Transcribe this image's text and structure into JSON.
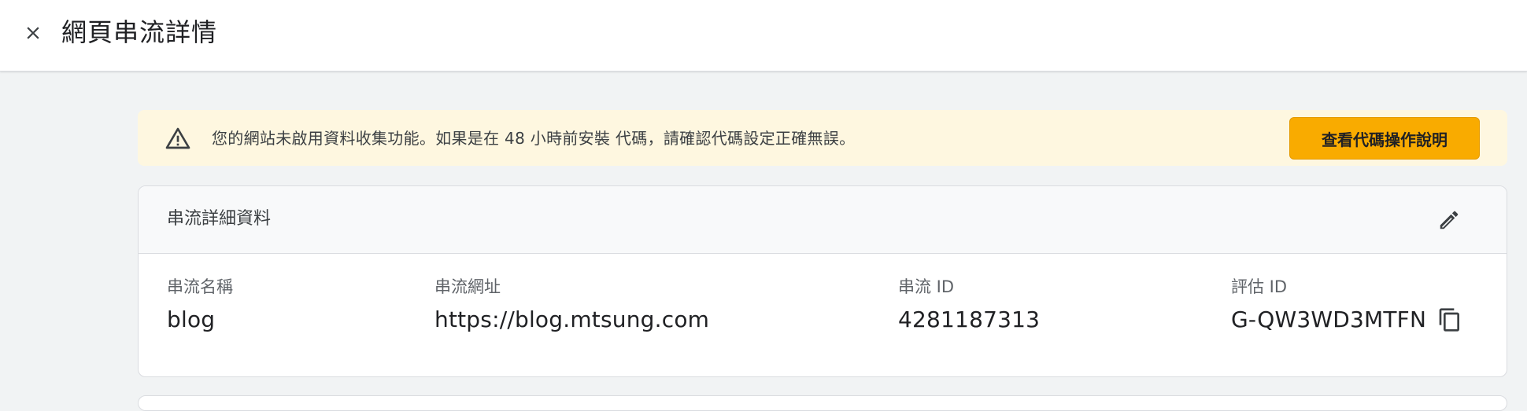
{
  "header": {
    "close_icon": "close-icon",
    "title": "網頁串流詳情"
  },
  "banner": {
    "icon": "warning-icon",
    "message": "您的網站未啟用資料收集功能。如果是在 48 小時前安裝 代碼，請確認代碼設定正確無誤。",
    "button_label": "查看代碼操作說明",
    "background_color": "#fef7e0",
    "button_color": "#f9ab00"
  },
  "stream_details": {
    "title": "串流詳細資料",
    "edit_icon": "edit-pencil-icon",
    "fields": [
      {
        "label": "串流名稱",
        "value": "blog"
      },
      {
        "label": "串流網址",
        "value": "https://blog.mtsung.com"
      },
      {
        "label": "串流 ID",
        "value": "4281187313"
      },
      {
        "label": "評估 ID",
        "value": "G-QW3WD3MTFN"
      }
    ],
    "copy_icon": "copy-icon"
  }
}
